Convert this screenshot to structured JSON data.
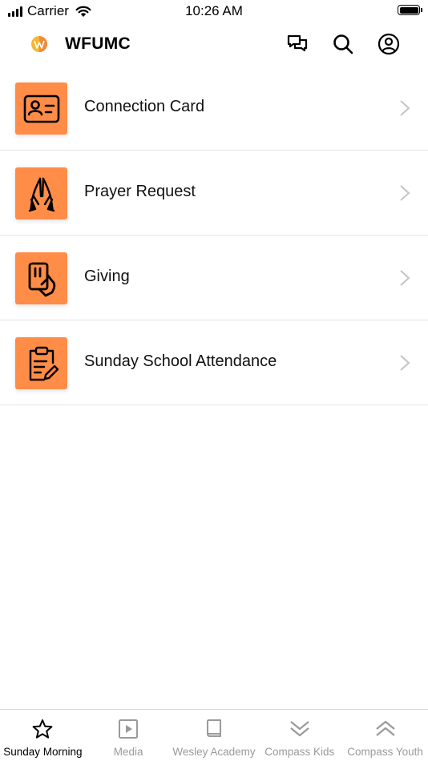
{
  "status_bar": {
    "carrier": "Carrier",
    "time": "10:26 AM"
  },
  "header": {
    "title": "WFUMC",
    "icons": [
      "chat-bubbles-icon",
      "search-icon",
      "account-icon"
    ]
  },
  "list": {
    "items": [
      {
        "label": "Connection Card",
        "icon": "id-card-icon"
      },
      {
        "label": "Prayer Request",
        "icon": "praying-hands-icon"
      },
      {
        "label": "Giving",
        "icon": "giving-card-icon"
      },
      {
        "label": "Sunday School Attendance",
        "icon": "clipboard-edit-icon"
      }
    ]
  },
  "tabbar": {
    "tabs": [
      {
        "label": "Sunday Morning",
        "icon": "star-icon",
        "active": true
      },
      {
        "label": "Media",
        "icon": "play-icon",
        "active": false
      },
      {
        "label": "Wesley Academy",
        "icon": "book-icon",
        "active": false
      },
      {
        "label": "Compass Kids",
        "icon": "double-chevron-down-icon",
        "active": false
      },
      {
        "label": "Compass Youth",
        "icon": "double-chevron-up-icon",
        "active": false
      }
    ]
  },
  "colors": {
    "accent": "#ff8c47",
    "tab_active": "#000000",
    "tab_inactive": "#9a9a9a"
  }
}
